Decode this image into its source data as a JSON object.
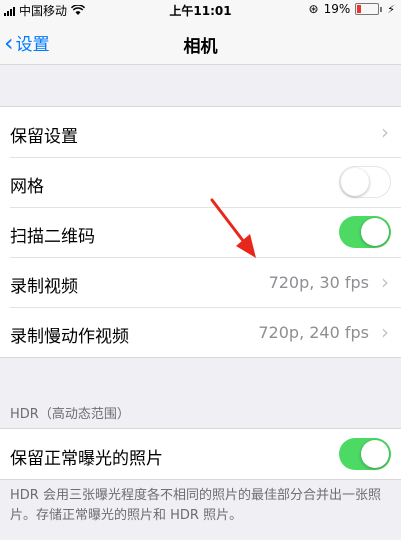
{
  "status_bar": {
    "carrier": "中国移动",
    "time": "上午11:01",
    "battery": "19%"
  },
  "nav": {
    "back_label": "设置",
    "title": "相机"
  },
  "group1": {
    "rows": [
      {
        "label": "保留设置",
        "control": "chevron"
      },
      {
        "label": "网格",
        "control": "toggle",
        "on": false
      },
      {
        "label": "扫描二维码",
        "control": "toggle",
        "on": true
      },
      {
        "label": "录制视频",
        "value": "720p, 30 fps",
        "control": "chevron"
      },
      {
        "label": "录制慢动作视频",
        "value": "720p, 240 fps",
        "control": "chevron"
      }
    ]
  },
  "hdr": {
    "section_header": "HDR（高动态范围）",
    "row_label": "保留正常曝光的照片",
    "row_on": true,
    "footer": "HDR 会用三张曝光程度各不相同的照片的最佳部分合并出一张照片。存储正常曝光的照片和 HDR 照片。"
  },
  "colors": {
    "accent": "#007aff",
    "toggle_on": "#4cd964",
    "background": "#efeff4",
    "arrow": "#e8261c"
  },
  "icons": [
    "wifi-icon",
    "location-icon",
    "battery-icon",
    "charging-icon",
    "chevron-left-icon",
    "chevron-right-icon"
  ]
}
